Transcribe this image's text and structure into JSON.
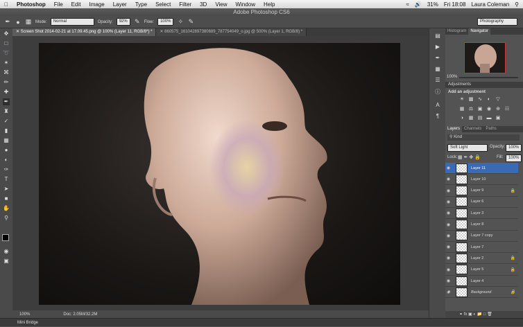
{
  "menubar": {
    "apple": "",
    "items": [
      "Photoshop",
      "File",
      "Edit",
      "Image",
      "Layer",
      "Type",
      "Select",
      "Filter",
      "3D",
      "View",
      "Window",
      "Help"
    ],
    "battery": "31%",
    "time": "Fri 18:08",
    "user": "Laura Coleman"
  },
  "window": {
    "title": "Adobe Photoshop CS6"
  },
  "options": {
    "mode_label": "Mode:",
    "mode_value": "Normal",
    "opacity_label": "Opacity:",
    "opacity_value": "92%",
    "flow_label": "Flow:",
    "flow_value": "100%",
    "workspace": "Photography"
  },
  "tabs": [
    {
      "label": "Screen Shot 2014-02-21 at 17.09.45.png @ 100% (Layer 11, RGB/8*) *",
      "active": true
    },
    {
      "label": "860575_161042897380689_787754049_o.jpg @ 500% (Layer 1, RGB/8) *",
      "active": false
    }
  ],
  "status": {
    "zoom": "100%",
    "doc": "Doc: 2.05M/32.2M"
  },
  "bridge": {
    "label": "Mini Bridge"
  },
  "navigator": {
    "tabs": [
      "Histogram",
      "Navigator"
    ],
    "zoom": "100%"
  },
  "adjustments": {
    "title": "Adjustments",
    "add_label": "Add an adjustment"
  },
  "layers_panel": {
    "tabs": [
      "Layers",
      "Channels",
      "Paths"
    ],
    "kind": "Kind",
    "blend": "Soft Light",
    "opacity_label": "Opacity:",
    "opacity": "100%",
    "lock_label": "Lock:",
    "fill_label": "Fill:",
    "fill": "100%",
    "layers": [
      {
        "name": "Layer 11",
        "selected": true,
        "locked": false
      },
      {
        "name": "Layer 10",
        "selected": false,
        "locked": false
      },
      {
        "name": "Layer 9",
        "selected": false,
        "locked": true
      },
      {
        "name": "Layer 6",
        "selected": false,
        "locked": false
      },
      {
        "name": "Layer 3",
        "selected": false,
        "locked": false
      },
      {
        "name": "Layer 8",
        "selected": false,
        "locked": false
      },
      {
        "name": "Layer 7 copy",
        "selected": false,
        "locked": false
      },
      {
        "name": "Layer 7",
        "selected": false,
        "locked": false
      },
      {
        "name": "Layer 2",
        "selected": false,
        "locked": true
      },
      {
        "name": "Layer 5",
        "selected": false,
        "locked": true
      },
      {
        "name": "Layer 4",
        "selected": false,
        "locked": false
      },
      {
        "name": "Background",
        "selected": false,
        "locked": true
      }
    ]
  }
}
